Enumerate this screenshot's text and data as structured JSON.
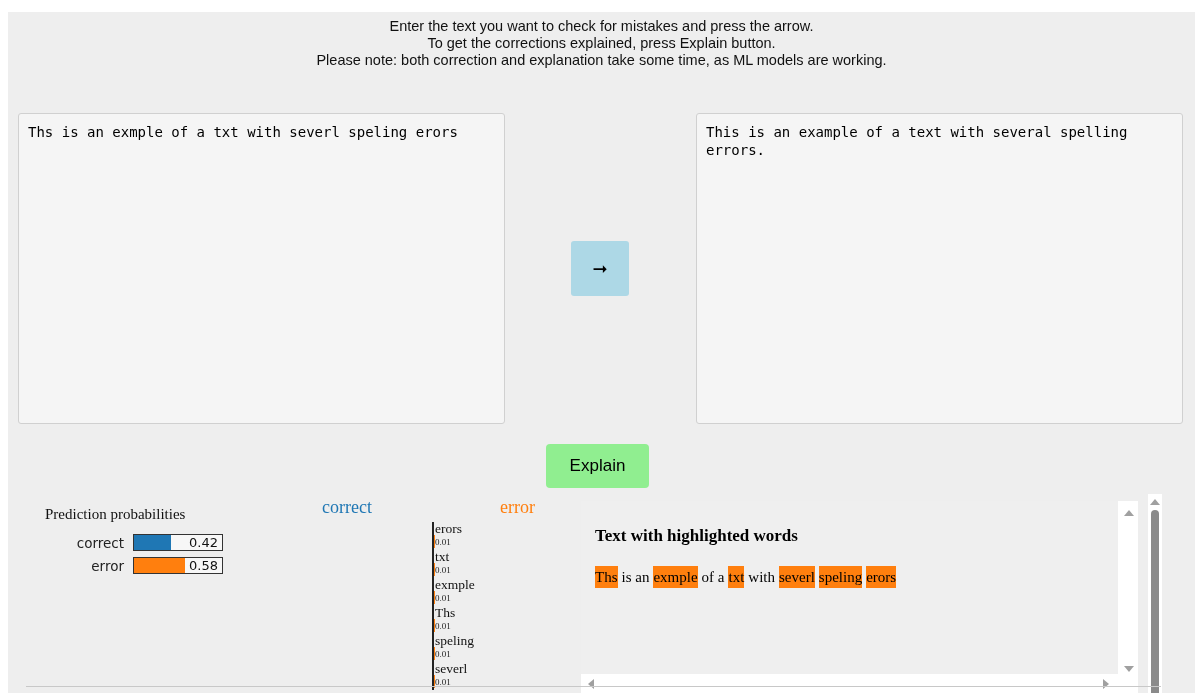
{
  "instructions": [
    "Enter the text you want to check for mistakes and press the arrow.",
    "To get the corrections explained, press Explain button.",
    "Please note: both correction and explanation take some time, as ML models are working."
  ],
  "input_text": "Ths is an exmple of a txt with severl speling erors",
  "output_text": "This is an example of a text with several spelling errors.",
  "arrow_button": "➞",
  "explain_button": "Explain",
  "prediction": {
    "title": "Prediction probabilities",
    "classes": [
      {
        "name": "correct",
        "level": 0.42,
        "reading": "0.42",
        "color": "#1f77b4"
      },
      {
        "name": "error",
        "level": 0.58,
        "reading": "0.58",
        "color": "#ff7f0e"
      }
    ]
  },
  "class_headings": [
    {
      "name": "correct",
      "color": "#1f77b4"
    },
    {
      "name": "error",
      "color": "#ff7f0e"
    }
  ],
  "features": [
    {
      "word": "erors",
      "value": "0.01"
    },
    {
      "word": "txt",
      "value": "0.01"
    },
    {
      "word": "exmple",
      "value": "0.01"
    },
    {
      "word": "Ths",
      "value": "0.01"
    },
    {
      "word": "speling",
      "value": "0.01"
    },
    {
      "word": "severl",
      "value": "0.01"
    }
  ],
  "highlight": {
    "title": "Text with highlighted words",
    "segments": [
      {
        "text": "Ths",
        "highlighted": true
      },
      {
        "text": "is an",
        "highlighted": false
      },
      {
        "text": "exmple",
        "highlighted": true
      },
      {
        "text": "of a",
        "highlighted": false
      },
      {
        "text": "txt",
        "highlighted": true
      },
      {
        "text": "with",
        "highlighted": false
      },
      {
        "text": "severl",
        "highlighted": true
      },
      {
        "text": "speling",
        "highlighted": true
      },
      {
        "text": "erors",
        "highlighted": true
      }
    ]
  }
}
